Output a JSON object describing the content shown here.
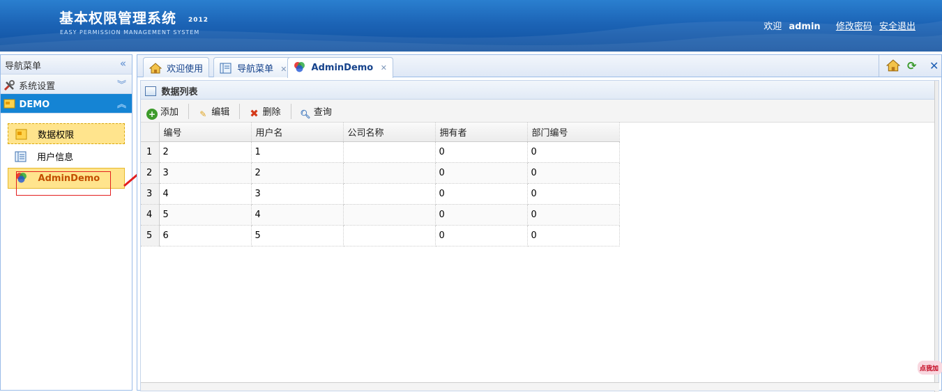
{
  "header": {
    "title": "基本权限管理系统",
    "year": "2012",
    "subtitle": "EASY PERMISSION MANAGEMENT SYSTEM",
    "welcome": "欢迎",
    "username": "admin",
    "change_password": "修改密码",
    "logout": "安全退出"
  },
  "west": {
    "title": "导航菜单",
    "groups": [
      {
        "label": "系统设置",
        "icon": "tools-icon"
      },
      {
        "label": "DEMO",
        "icon": "folder-icon"
      }
    ],
    "items": [
      {
        "label": "数据权限",
        "icon": "folder-icon"
      },
      {
        "label": "用户信息",
        "icon": "list-icon"
      },
      {
        "label": "AdminDemo",
        "icon": "color-wheel-icon"
      }
    ]
  },
  "tabs": [
    {
      "label": "欢迎使用",
      "icon": "home-icon"
    },
    {
      "label": "导航菜单",
      "icon": "list-icon"
    },
    {
      "label": "AdminDemo",
      "icon": "color-wheel-icon"
    }
  ],
  "grid": {
    "title": "数据列表",
    "toolbar": {
      "add": "添加",
      "edit": "编辑",
      "delete": "删除",
      "query": "查询"
    },
    "columns": [
      "编号",
      "用户名",
      "公司名称",
      "拥有者",
      "部门编号"
    ],
    "rows": [
      {
        "rn": "1",
        "cells": [
          "2",
          "1",
          "",
          "0",
          "0"
        ]
      },
      {
        "rn": "2",
        "cells": [
          "3",
          "2",
          "",
          "0",
          "0"
        ]
      },
      {
        "rn": "3",
        "cells": [
          "4",
          "3",
          "",
          "0",
          "0"
        ]
      },
      {
        "rn": "4",
        "cells": [
          "5",
          "4",
          "",
          "0",
          "0"
        ]
      },
      {
        "rn": "5",
        "cells": [
          "6",
          "5",
          "",
          "0",
          "0"
        ]
      }
    ]
  },
  "promo": "点我加"
}
